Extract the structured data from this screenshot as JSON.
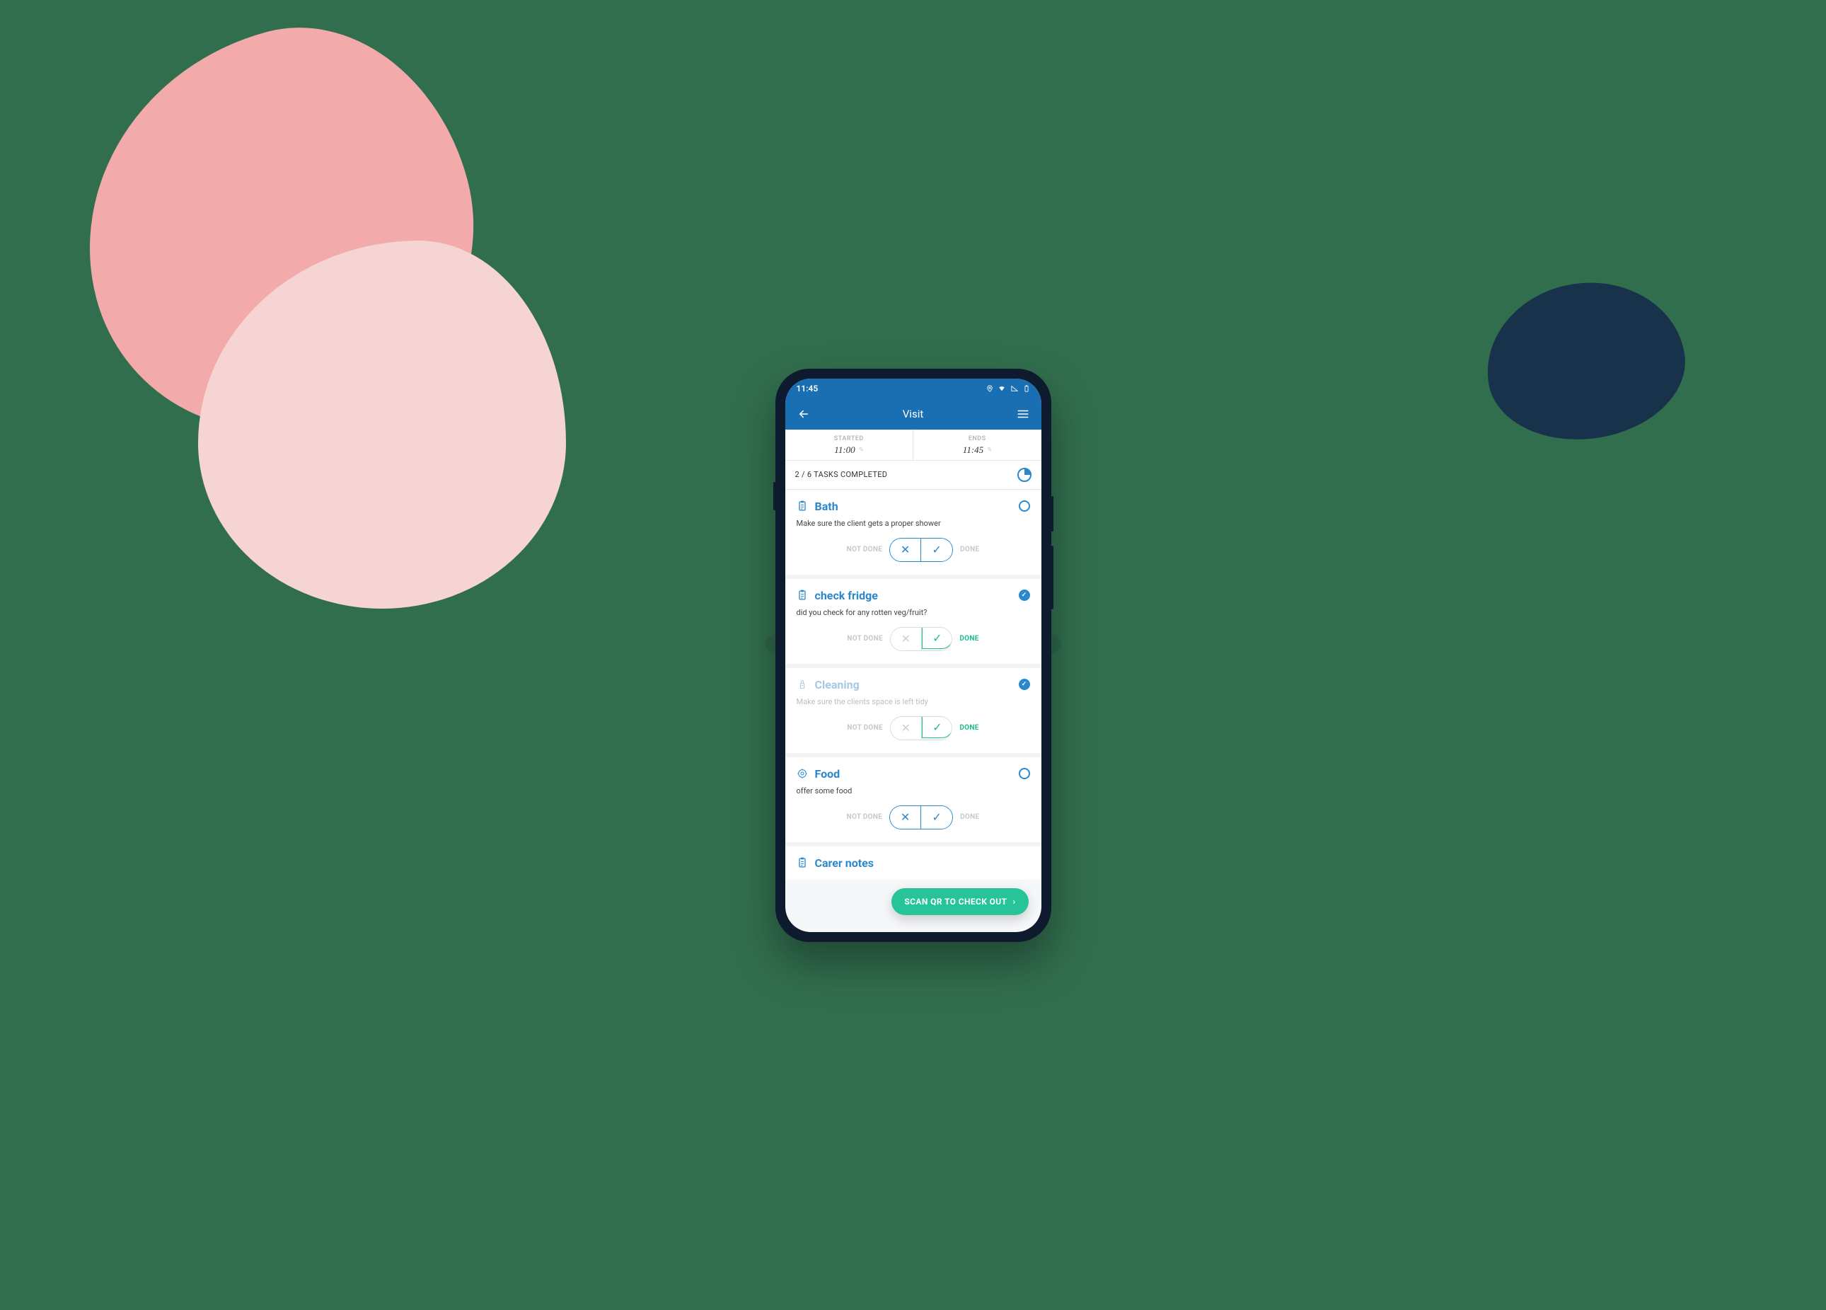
{
  "status": {
    "time": "11:45"
  },
  "header": {
    "title": "Visit"
  },
  "times": {
    "started_label": "STARTED",
    "started_value": "11:00",
    "ends_label": "ENDS",
    "ends_value": "11:45"
  },
  "progress": {
    "text": "2 / 6 TASKS COMPLETED"
  },
  "labels": {
    "not_done": "NOT DONE",
    "done": "DONE"
  },
  "tasks": [
    {
      "title": "Bath",
      "desc": "Make sure the client gets a proper shower",
      "state": "pending"
    },
    {
      "title": "check fridge",
      "desc": "did you check for any rotten veg/fruit?",
      "state": "done"
    },
    {
      "title": "Cleaning",
      "desc": "Make sure the clients space is left tidy",
      "state": "done-faded"
    },
    {
      "title": "Food",
      "desc": "offer some food",
      "state": "pending"
    }
  ],
  "notes": {
    "title": "Carer notes"
  },
  "fab": {
    "label": "SCAN QR TO CHECK OUT"
  }
}
